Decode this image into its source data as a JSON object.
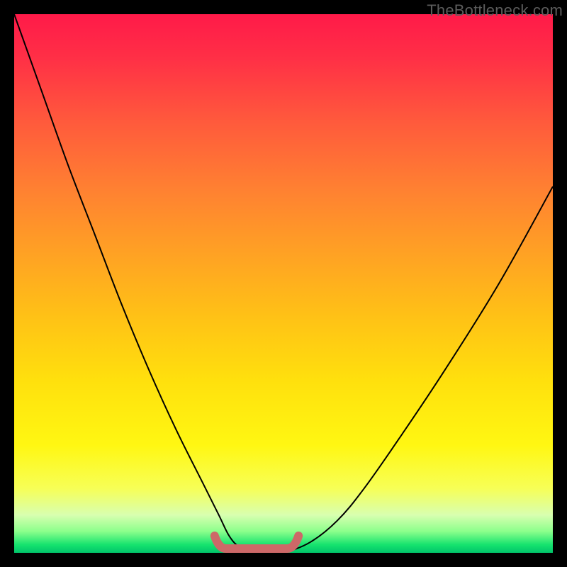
{
  "watermark": "TheBottleneck.com",
  "chart_data": {
    "type": "line",
    "title": "",
    "xlabel": "",
    "ylabel": "",
    "xlim": [
      0,
      100
    ],
    "ylim": [
      0,
      100
    ],
    "grid": false,
    "legend": false,
    "background_gradient": {
      "top": "#ff1a49",
      "mid": "#ffe00d",
      "bottom": "#00c46a"
    },
    "series": [
      {
        "name": "bottleneck-curve",
        "x": [
          0,
          5,
          10,
          15,
          20,
          25,
          30,
          35,
          38,
          40,
          42,
          45,
          48,
          50,
          55,
          60,
          65,
          72,
          80,
          90,
          100
        ],
        "values": [
          100,
          86,
          72,
          59,
          46,
          34,
          23,
          13,
          7,
          3,
          1,
          0,
          0,
          0,
          2,
          6,
          12,
          22,
          34,
          50,
          68
        ]
      }
    ],
    "flat_region": {
      "x_start": 38,
      "x_end": 52,
      "color": "#cd6868"
    }
  }
}
